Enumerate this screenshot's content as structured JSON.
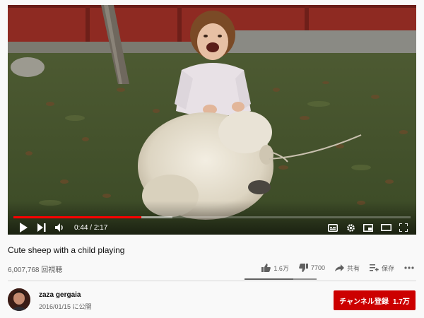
{
  "player": {
    "current_time": "0:44",
    "duration": "2:17",
    "time_separator": "/",
    "played_fraction": 0.3212,
    "buffered_fraction": 0.4
  },
  "video": {
    "title": "Cute sheep with a child playing",
    "views": "6,007,768 回視聴"
  },
  "actions": {
    "likes": "1.6万",
    "dislikes": "7700",
    "share_label": "共有",
    "save_label": "保存",
    "like_fraction": 0.675
  },
  "channel": {
    "name": "zaza gergaia",
    "published": "2016/01/15 に公開"
  },
  "subscribe": {
    "label": "チャンネル登録",
    "count": "1.7万"
  },
  "colors": {
    "accent_red": "#ff0000",
    "subscribe_bg": "#cc0000",
    "text_primary": "#0f0f0f",
    "text_secondary": "#606060"
  },
  "icons": [
    "play-icon",
    "next-icon",
    "volume-icon",
    "subtitles-icon",
    "settings-icon",
    "miniplayer-icon",
    "theater-icon",
    "fullscreen-icon",
    "thumb-up-icon",
    "thumb-down-icon",
    "share-icon",
    "add-to-playlist-icon",
    "more-icon"
  ]
}
